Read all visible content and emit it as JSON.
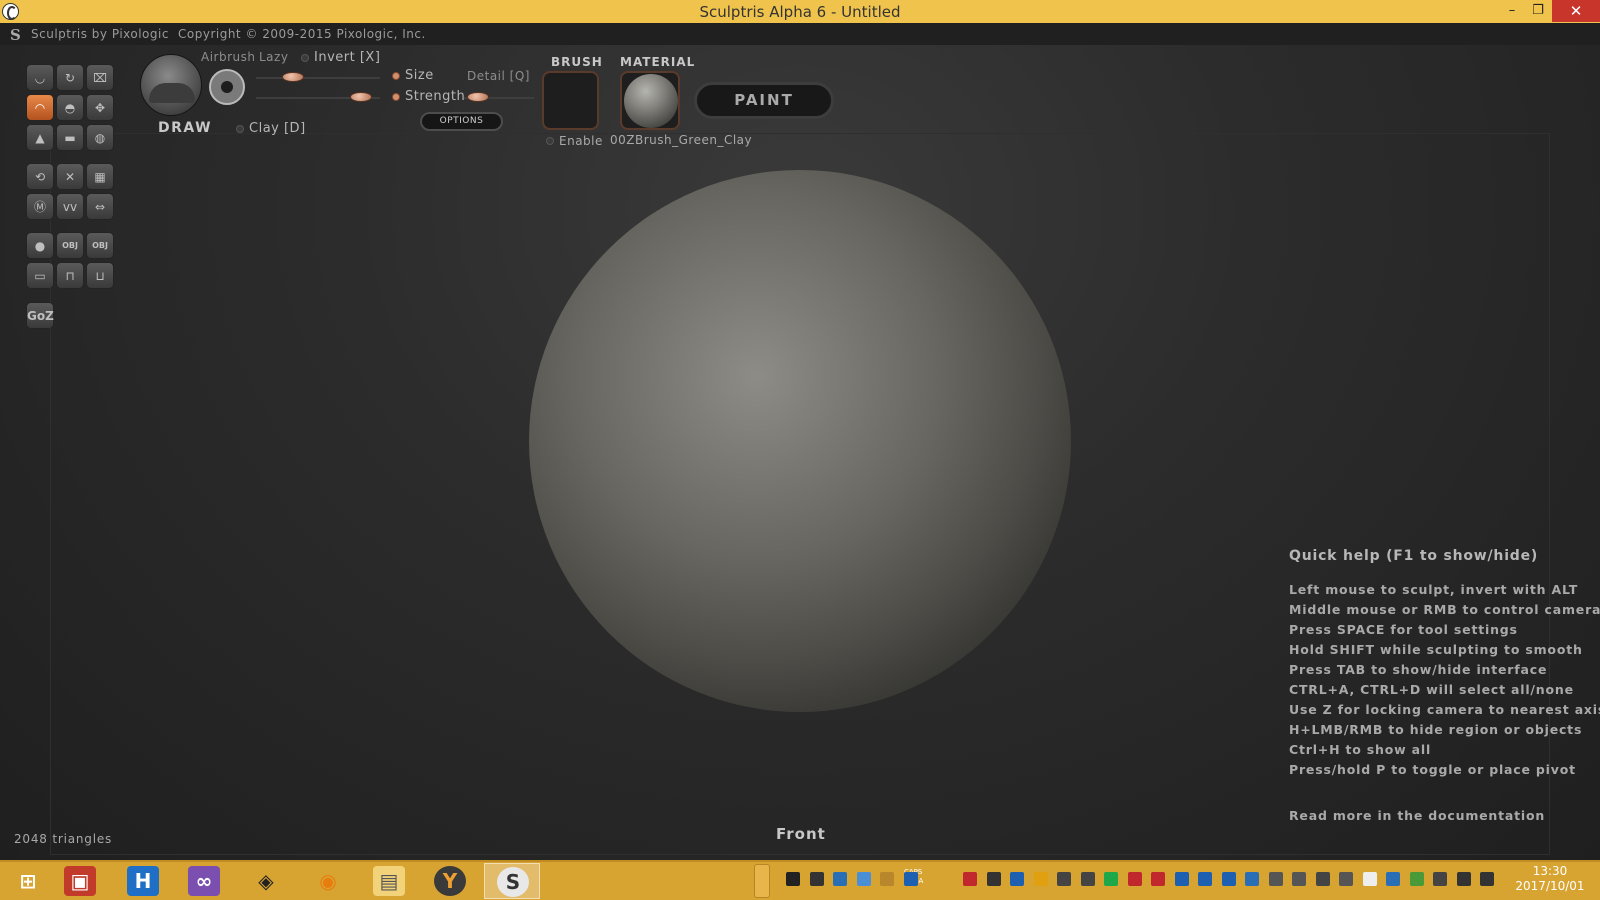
{
  "window": {
    "title": "Sculptris Alpha 6 - Untitled",
    "minimize": "–",
    "maximize": "❐",
    "close": "✕"
  },
  "header": {
    "logo_glyph": "S",
    "brand": "Sculptris by Pixologic",
    "copyright": "Copyright © 2009-2015 Pixologic, Inc."
  },
  "toolbar": {
    "tools": [
      {
        "icon": "crease-icon"
      },
      {
        "icon": "rotate-icon"
      },
      {
        "icon": "scale-icon"
      },
      {
        "icon": "draw-icon",
        "active": true
      },
      {
        "icon": "inflate-icon"
      },
      {
        "icon": "grab-icon"
      },
      {
        "icon": "pinch-icon"
      },
      {
        "icon": "flatten-icon"
      },
      {
        "icon": "smooth-icon"
      },
      {
        "icon": "reduce-brush-icon"
      },
      {
        "icon": "symmetry-icon"
      },
      {
        "icon": "wireframe-icon"
      },
      {
        "icon": "subdivide-icon"
      },
      {
        "icon": "reduce-icon"
      },
      {
        "icon": "mirror-icon"
      },
      {
        "icon": "new-sphere-icon"
      },
      {
        "icon": "import-obj-icon",
        "label": "OBJ"
      },
      {
        "icon": "export-obj-icon",
        "label": "OBJ"
      },
      {
        "icon": "new-plane-icon"
      },
      {
        "icon": "open-icon"
      },
      {
        "icon": "save-icon"
      },
      {
        "icon": "goz-icon",
        "label": "GoZ"
      }
    ]
  },
  "brush_panel": {
    "tool_name": "DRAW",
    "airbrush_label": "Airbrush",
    "lazy_label": "Lazy",
    "invert_label": "Invert [X]",
    "clay_label": "Clay [D]",
    "size_label": "Size",
    "detail_label": "Detail [Q]",
    "strength_label": "Strength",
    "options_label": "OPTIONS",
    "size_value": 0.3,
    "strength_value": 0.85,
    "detail_value": 0.2
  },
  "brush_section": {
    "heading": "BRUSH",
    "enable_label": "Enable"
  },
  "material_section": {
    "heading": "MATERIAL",
    "name": "00ZBrush_Green_Clay"
  },
  "paint_button": "PAINT",
  "quick_help": {
    "title": "Quick help (F1 to show/hide)",
    "lines": [
      "Left mouse to sculpt, invert with ALT",
      "Middle mouse or RMB to control camera",
      "Press SPACE for tool settings",
      "Hold SHIFT while sculpting to smooth",
      "Press TAB to show/hide interface",
      "CTRL+A, CTRL+D will select all/none",
      "Use Z for locking camera to nearest axis",
      "H+LMB/RMB to hide region or objects",
      "Ctrl+H to show all",
      "Press/hold P to toggle or place pivot"
    ],
    "more": "Read more in the documentation"
  },
  "viewport": {
    "view_name": "Front",
    "triangle_count": "2048 triangles"
  },
  "taskbar": {
    "apps": [
      {
        "icon": "windows-start-icon"
      },
      {
        "icon": "train-app-icon"
      },
      {
        "icon": "dictionary-app-icon"
      },
      {
        "icon": "visual-studio-icon"
      },
      {
        "icon": "unity-icon"
      },
      {
        "icon": "blender-icon"
      },
      {
        "icon": "file-explorer-icon"
      },
      {
        "icon": "app-orange-icon"
      },
      {
        "icon": "sculptris-icon",
        "active": true
      }
    ],
    "tray": {
      "caps": "CAPS",
      "kana": "KANA",
      "time": "13:30",
      "date": "2017/10/01"
    }
  },
  "colors": {
    "titlebar": "#f0c44c",
    "taskbar": "#d7a331",
    "active_tool": "#d66a2e",
    "background": "#1c1c1c"
  }
}
